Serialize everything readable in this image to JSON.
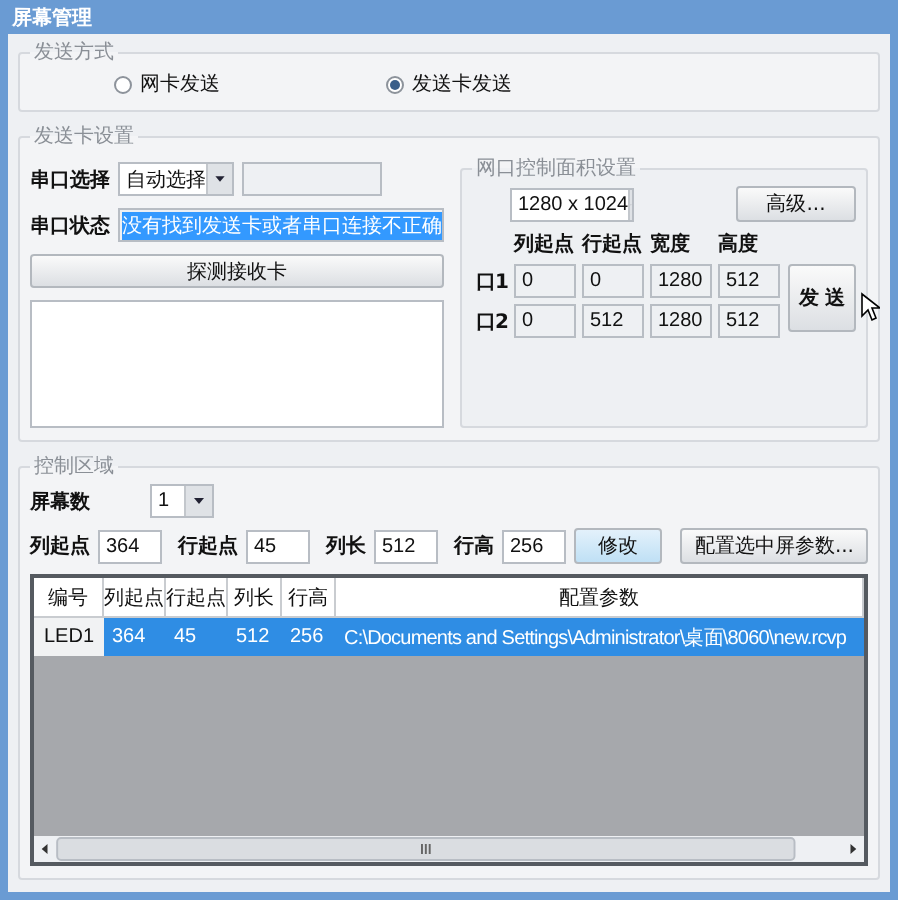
{
  "window": {
    "title": "屏幕管理"
  },
  "send_mode": {
    "title": "发送方式",
    "options": [
      {
        "label": "网卡发送",
        "selected": false
      },
      {
        "label": "发送卡发送",
        "selected": true
      }
    ]
  },
  "card_settings": {
    "title": "发送卡设置",
    "port_label": "串口选择",
    "port_value": "自动选择",
    "status_label": "串口状态",
    "status_value": "没有找到发送卡或者串口连接不正确",
    "detect_button": "探测接收卡"
  },
  "net_area": {
    "title": "网口控制面积设置",
    "resolution": "1280 x 1024",
    "advanced_button": "高级...",
    "columns": [
      "列起点",
      "行起点",
      "宽度",
      "高度"
    ],
    "rows": [
      {
        "label": "口1",
        "values": [
          "0",
          "0",
          "1280",
          "512"
        ]
      },
      {
        "label": "口2",
        "values": [
          "0",
          "512",
          "1280",
          "512"
        ]
      }
    ],
    "send_button": "发 送"
  },
  "control_area": {
    "title": "控制区域",
    "screen_count_label": "屏幕数",
    "screen_count": "1",
    "fields": [
      {
        "label": "列起点",
        "value": "364"
      },
      {
        "label": "行起点",
        "value": "45"
      },
      {
        "label": "列长",
        "value": "512"
      },
      {
        "label": "行高",
        "value": "256"
      }
    ],
    "modify_button": "修改",
    "config_button": "配置选中屏参数...",
    "table": {
      "columns": [
        "编号",
        "列起点",
        "行起点",
        "列长",
        "行高",
        "配置参数"
      ],
      "rows": [
        {
          "cells": [
            "LED1",
            "364",
            "45",
            "512",
            "256",
            "C:\\Documents and Settings\\Administrator\\桌面\\8060\\new.rcvp"
          ],
          "selected": true
        }
      ]
    }
  }
}
